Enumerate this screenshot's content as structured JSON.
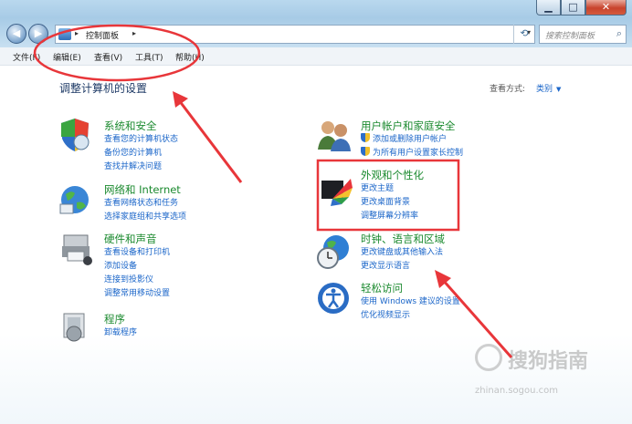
{
  "window": {
    "address_path": "控制面板",
    "search_placeholder": "搜索控制面板"
  },
  "menu": [
    "文件(F)",
    "编辑(E)",
    "查看(V)",
    "工具(T)",
    "帮助(H)"
  ],
  "page_title": "调整计算机的设置",
  "view_by": {
    "label": "查看方式:",
    "value": "类别"
  },
  "categories_left": [
    {
      "title": "系统和安全",
      "links": [
        "查看您的计算机状态",
        "备份您的计算机",
        "查找并解决问题"
      ]
    },
    {
      "title": "网络和 Internet",
      "links": [
        "查看网络状态和任务",
        "选择家庭组和共享选项"
      ]
    },
    {
      "title": "硬件和声音",
      "links": [
        "查看设备和打印机",
        "添加设备",
        "连接到投影仪",
        "调整常用移动设置"
      ]
    },
    {
      "title": "程序",
      "links": [
        "卸载程序"
      ]
    }
  ],
  "categories_right": [
    {
      "title": "用户帐户和家庭安全",
      "links": [
        "添加或删除用户帐户",
        "为所有用户设置家长控制"
      ]
    },
    {
      "title": "外观和个性化",
      "links": [
        "更改主题",
        "更改桌面背景",
        "调整屏幕分辨率"
      ]
    },
    {
      "title": "时钟、语言和区域",
      "links": [
        "更改键盘或其他输入法",
        "更改显示语言"
      ]
    },
    {
      "title": "轻松访问",
      "links": [
        "使用 Windows 建议的设置",
        "优化视频显示"
      ]
    }
  ],
  "watermark": {
    "main": "搜狗指南",
    "sub": "zhinan.sogou.com"
  },
  "colors": {
    "annotation": "#e8363a",
    "link": "#1b66c9",
    "category_title": "#1b8a2f"
  },
  "icons": [
    "back-arrow-icon",
    "forward-arrow-icon",
    "control-panel-icon",
    "refresh-icon",
    "search-icon",
    "shield-icon"
  ]
}
